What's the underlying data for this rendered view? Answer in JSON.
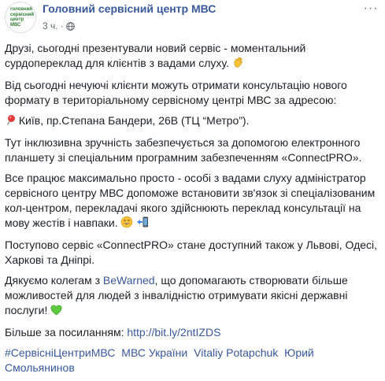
{
  "header": {
    "page_name": "Головний сервісний центр МВС",
    "avatar_text": "головний сервісний центр МВС",
    "time": "3 ч.",
    "separator": "·",
    "more_label": "···"
  },
  "post": {
    "p1": "Друзі, сьогодні презентували новий сервіс - моментальний сурдопереклад для клієнтів з вадами слуху.",
    "p2": "Від сьогодні нечуючі клієнти можуть отримати консультацію нового формату в територіальному сервісному центрі МВС за адресою:",
    "p3": "Київ, пр.Степана Бандери, 26В (ТЦ “Метро”).",
    "p4": "Тут інклюзивна зручність забезпечується за допомогою електронного планшету зі спеціальним програмним забезпеченням «ConnectPRO».",
    "p5": "Все працює максимально просто - особі з вадами слуху адміністратор сервісного центру МВС допоможе встановити зв'язок зі спеціалізованим кол-центром, перекладачі якого здійснюють переклад консультації на мову жестів і навпаки.",
    "p6": "Поступово сервіс «ConnectPRO» стане доступний також у Львові, Одесі, Харкові та Дніпрі.",
    "p7_before": "Дякуємо колегам з",
    "p7_link": "BeWarned",
    "p7_after": ", що допомагають створювати більше можливостей для людей з інвалідністю отримувати якісні державні послуги!",
    "p8_label": "Більше за посиланням:",
    "p8_link": "http://bit.ly/2ntIZDS",
    "hashtags": [
      "#СервісніЦентриМВС",
      "МВС України",
      "Vitaliy Potapchuk",
      "Юрий Смольянинов"
    ]
  },
  "icons": {
    "wave": "waving-hand-emoji",
    "pin": "round-pushpin-emoji",
    "grin": "smiling-face-emoji",
    "phone": "mobile-phone-arrow-emoji",
    "heart": "green-heart-emoji",
    "globe": "globe-icon"
  },
  "colors": {
    "link": "#385898",
    "text": "#1c1e21",
    "meta": "#606770",
    "avatar_text": "#2e7d32"
  }
}
